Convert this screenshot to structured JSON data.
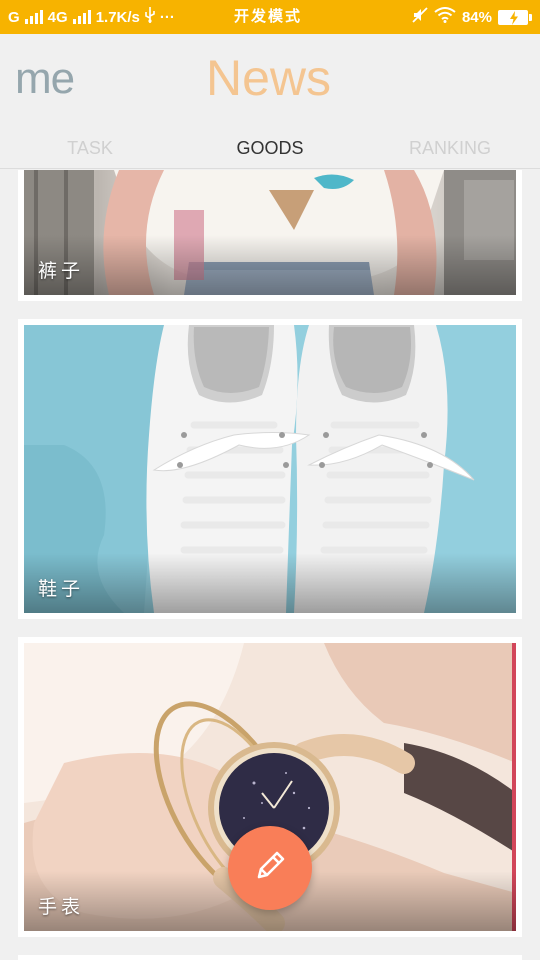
{
  "status_bar": {
    "network_g": "G",
    "network_4g": "4G",
    "speed": "1.7K/s",
    "usb_icon": "usb-icon",
    "more": "···",
    "mode": "开发模式",
    "battery": "84%",
    "icons": [
      "signal-icon",
      "mute-icon",
      "wifi-icon",
      "battery-charging-icon"
    ]
  },
  "header": {
    "left_title": "me",
    "center_title": "News",
    "colors": {
      "me": "#95a6ad",
      "news": "#f4c591"
    }
  },
  "tabs": [
    {
      "label": "TASK",
      "active": false
    },
    {
      "label": "GOODS",
      "active": true
    },
    {
      "label": "RANKING",
      "active": false
    }
  ],
  "goods": [
    {
      "caption": "裤子",
      "image": "pants-photo"
    },
    {
      "caption": "鞋子",
      "image": "sneakers-photo"
    },
    {
      "caption": "手表",
      "image": "watch-photo"
    }
  ],
  "fab": {
    "icon": "pencil-icon",
    "color": "#f97e58"
  },
  "colors": {
    "status_bar": "#f7b300",
    "background": "#f0f0f0"
  }
}
